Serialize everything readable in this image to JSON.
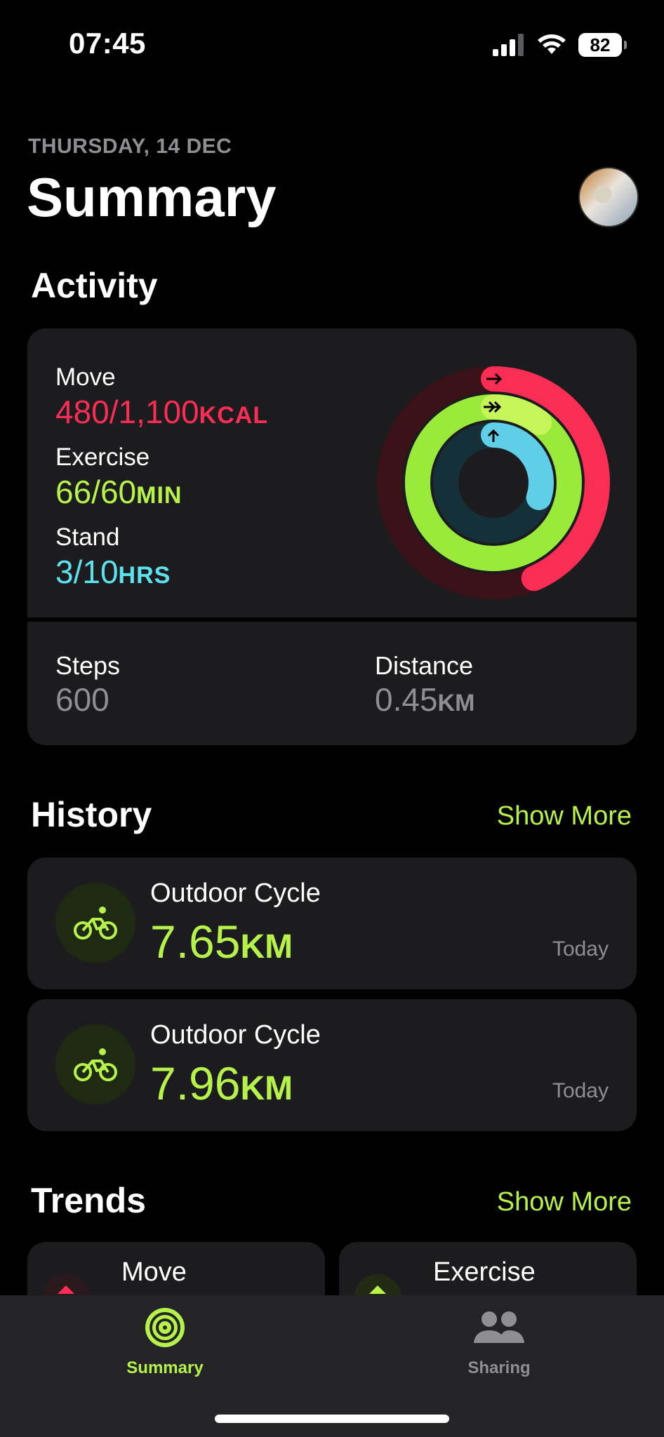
{
  "status_bar": {
    "time": "07:45",
    "battery": "82"
  },
  "header": {
    "date": "THURSDAY, 14 DEC",
    "title": "Summary"
  },
  "activity": {
    "title": "Activity",
    "move": {
      "label": "Move",
      "value": "480/1,100",
      "unit": "KCAL",
      "progress": 0.436
    },
    "exercise": {
      "label": "Exercise",
      "value": "66/60",
      "unit": "MIN",
      "progress": 1.1
    },
    "stand": {
      "label": "Stand",
      "value": "3/10",
      "unit": "HRS",
      "progress": 0.3
    },
    "steps": {
      "label": "Steps",
      "value": "600"
    },
    "distance": {
      "label": "Distance",
      "value": "0.45",
      "unit": "KM"
    }
  },
  "history": {
    "title": "History",
    "show_more": "Show More",
    "items": [
      {
        "name": "Outdoor Cycle",
        "value": "7.65",
        "unit": "KM",
        "date": "Today"
      },
      {
        "name": "Outdoor Cycle",
        "value": "7.96",
        "unit": "KM",
        "date": "Today"
      }
    ]
  },
  "trends": {
    "title": "Trends",
    "show_more": "Show More",
    "items": [
      {
        "label": "Move"
      },
      {
        "label": "Exercise"
      }
    ]
  },
  "tabbar": {
    "tabs": [
      {
        "label": "Summary",
        "active": true
      },
      {
        "label": "Sharing",
        "active": false
      }
    ]
  },
  "colors": {
    "move": "#fa2d55",
    "exercise": "#b6f24a",
    "stand": "#5ee1ee",
    "accent": "#b6f24a"
  },
  "icons": [
    "signal-icon",
    "wifi-icon",
    "battery-icon",
    "cycling-icon",
    "activity-rings-icon",
    "sharing-icon"
  ]
}
